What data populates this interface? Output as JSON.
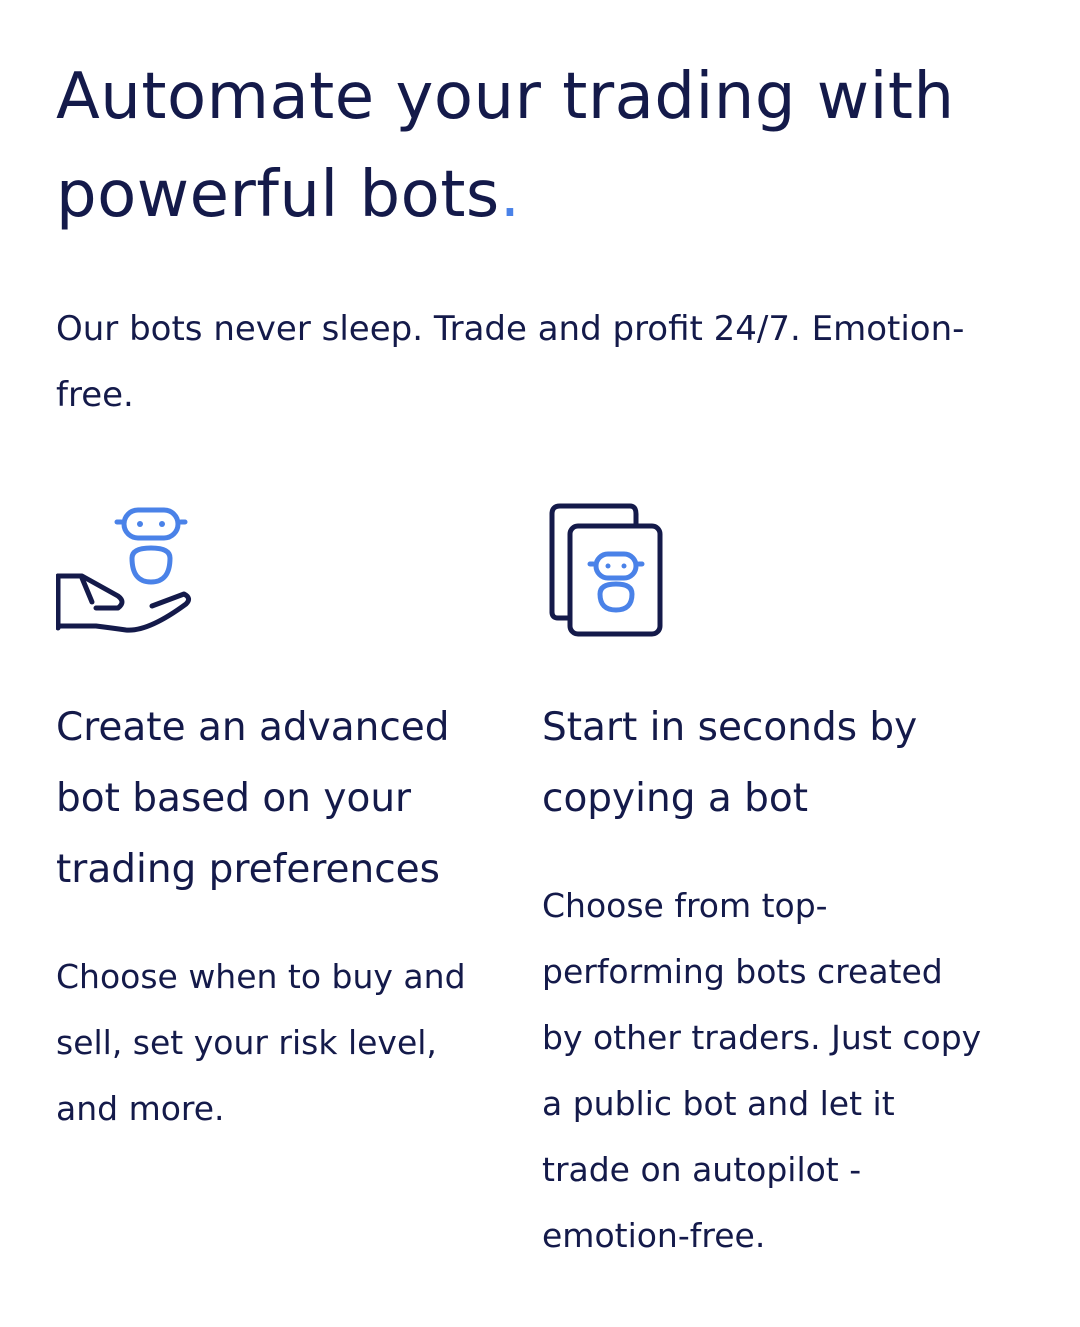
{
  "hero": {
    "title": "Automate your trading with powerful bots",
    "title_dot": ".",
    "subtitle": "Our bots never sleep. Trade and profit 24/7. Emotion-free."
  },
  "features": [
    {
      "icon": "robot-in-hand-icon",
      "title": "Create an advanced bot based on your trading preferences",
      "description": "Choose when to buy and sell, set your risk level, and more."
    },
    {
      "icon": "copy-bot-icon",
      "title": "Start in seconds by copying a bot",
      "description": "Choose from top-performing bots created by other traders. Just copy a public bot and let it trade on autopilot - emotion-free."
    }
  ],
  "colors": {
    "text": "#141a4a",
    "accent": "#4a82e8"
  }
}
